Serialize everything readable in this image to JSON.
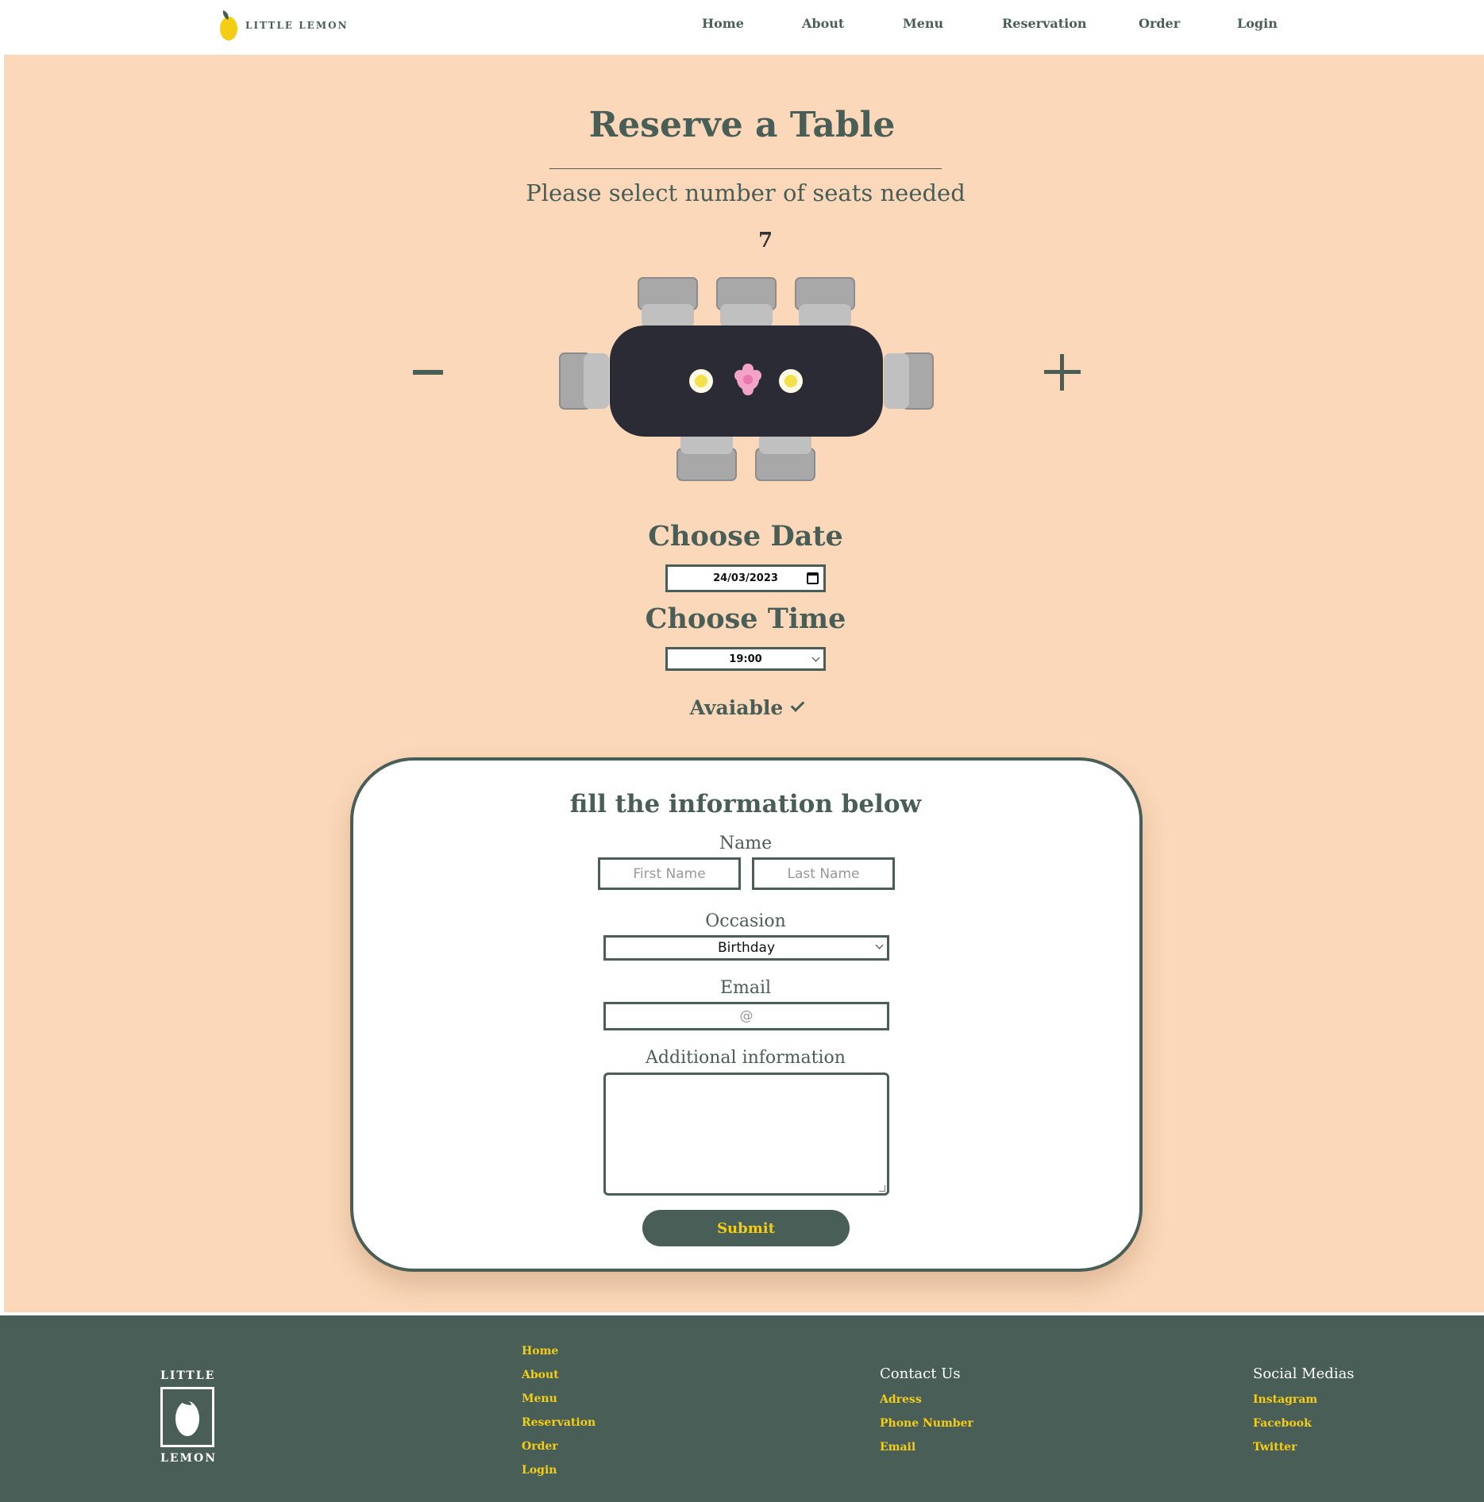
{
  "header": {
    "logo_text": "LITTLE LEMON",
    "nav": [
      "Home",
      "About",
      "Menu",
      "Reservation",
      "Order",
      "Login"
    ]
  },
  "reserve": {
    "title": "Reserve a Table",
    "subtitle": "Please select number of seats needed",
    "seat_count": "7",
    "date_label": "Choose Date",
    "date_value": "24/03/2023",
    "time_label": "Choose Time",
    "time_value": "19:00",
    "availability": "Avaiable"
  },
  "form": {
    "title": "fill the information below",
    "name_label": "Name",
    "first_name_placeholder": "First Name",
    "last_name_placeholder": "Last Name",
    "occasion_label": "Occasion",
    "occasion_value": "Birthday",
    "email_label": "Email",
    "email_placeholder": "@",
    "additional_label": "Additional information",
    "submit_label": "Submit"
  },
  "footer": {
    "logo_top": "LITTLE",
    "logo_bottom": "LEMON",
    "nav": [
      "Home",
      "About",
      "Menu",
      "Reservation",
      "Order",
      "Login"
    ],
    "contact_heading": "Contact Us",
    "contact": [
      "Adress",
      "Phone Number",
      "Email"
    ],
    "social_heading": "Social Medias",
    "social": [
      "Instagram",
      "Facebook",
      "Twitter"
    ]
  },
  "colors": {
    "primary": "#495e57",
    "accent": "#f4ce14",
    "background": "#fad8b9",
    "table": "#2b2b36"
  }
}
